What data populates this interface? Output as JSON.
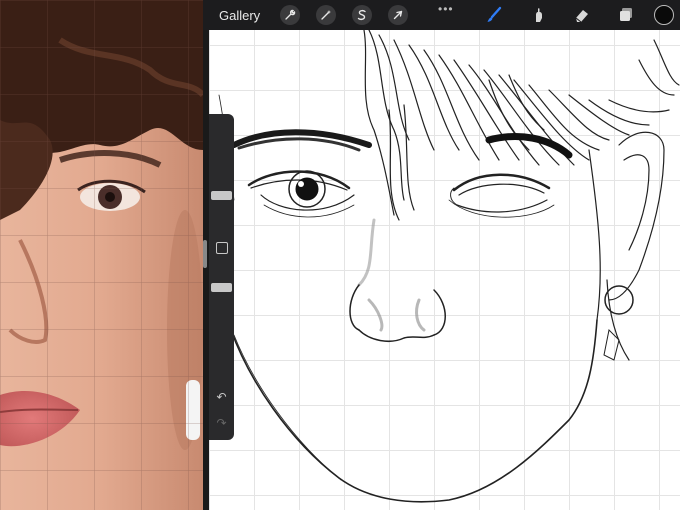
{
  "toolbar": {
    "gallery_label": "Gallery",
    "more_dots": "•••",
    "left_tools": [
      "wrench-icon",
      "magic-wand-icon",
      "selection-s-icon",
      "transform-arrow-icon"
    ],
    "right_tools": [
      "brush-icon",
      "smudge-icon",
      "eraser-icon",
      "layers-icon"
    ],
    "active_tool": "brush-icon",
    "accent_color": "#2f7cf6",
    "current_color": "#0a0a0a"
  },
  "side_panel": {
    "brush_size_level": 0.31,
    "opacity_level": 0.51,
    "undo_glyph": "↶",
    "redo_glyph": "↷"
  },
  "colors": {
    "toolbar_bg": "#1c1c1e",
    "canvas_bg": "#ffffff",
    "grid_line": "#e4e4e4",
    "skin_tone": "#d9a48b",
    "hair": "#3a1f15"
  }
}
